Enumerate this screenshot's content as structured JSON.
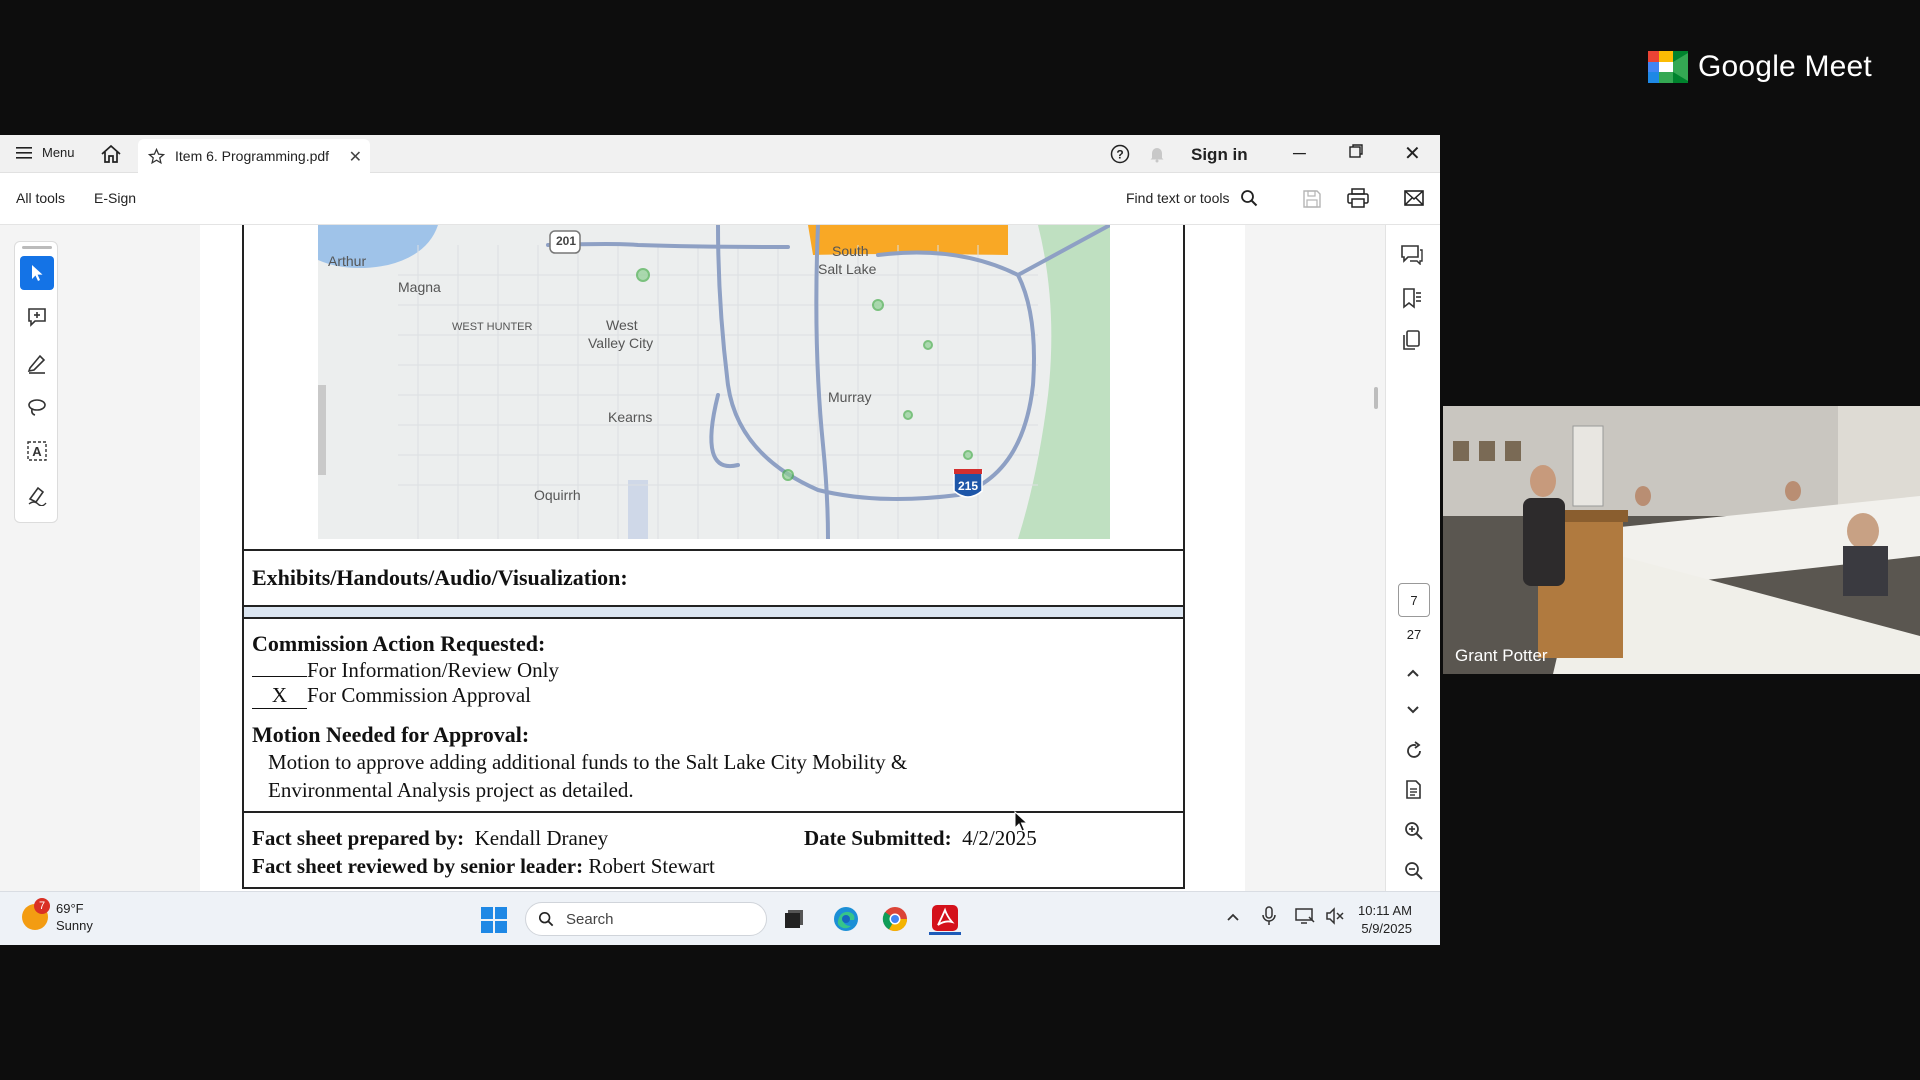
{
  "meet": {
    "logo_text": "Google Meet",
    "participant_name": "Grant Potter"
  },
  "acrobat": {
    "titlebar": {
      "menu_label": "Menu",
      "tab_title": "Item 6. Programming.pdf",
      "sign_in_label": "Sign in"
    },
    "toolbar": {
      "all_tools_label": "All tools",
      "esign_label": "E-Sign",
      "find_label": "Find text or tools"
    },
    "navigation": {
      "current_page": "7",
      "total_pages": "27"
    }
  },
  "document": {
    "map_labels": {
      "arthur": "Arthur",
      "magna": "Magna",
      "west_hunter": "WEST HUNTER",
      "west_valley_1": "West",
      "west_valley_2": "Valley City",
      "kearns": "Kearns",
      "oquirrh": "Oquirrh",
      "south_salt_lake_1": "South",
      "south_salt_lake_2": "Salt Lake",
      "murray": "Murray",
      "route_201": "201",
      "route_215": "215"
    },
    "exhibits_heading": "Exhibits/Handouts/Audio/Visualization:",
    "action_heading": "Commission Action Requested:",
    "option_review_mark": "",
    "option_review": "For Information/Review Only",
    "option_approval_mark": "X",
    "option_approval": "For Commission Approval",
    "motion_heading": "Motion Needed for Approval:",
    "motion_line1": "Motion to approve adding additional funds to the Salt Lake City Mobility &",
    "motion_line2": "Environmental Analysis project as detailed.",
    "prepared_by_label": "Fact sheet prepared by:",
    "prepared_by_value": "Kendall Draney",
    "date_label": "Date Submitted:",
    "date_value": "4/2/2025",
    "reviewed_by_label": "Fact sheet reviewed by senior leader:",
    "reviewed_by_value": "Robert Stewart"
  },
  "taskbar": {
    "weather_badge": "7",
    "weather_temp": "69°F",
    "weather_condition": "Sunny",
    "search_placeholder": "Search",
    "time": "10:11 AM",
    "date": "5/9/2025"
  },
  "colors": {
    "acrobat_active_tool": "#1473e6",
    "acrobat_red": "#d4111b",
    "doc_blue_band": "#dbe5f1",
    "map_orange": "#f9a825"
  }
}
